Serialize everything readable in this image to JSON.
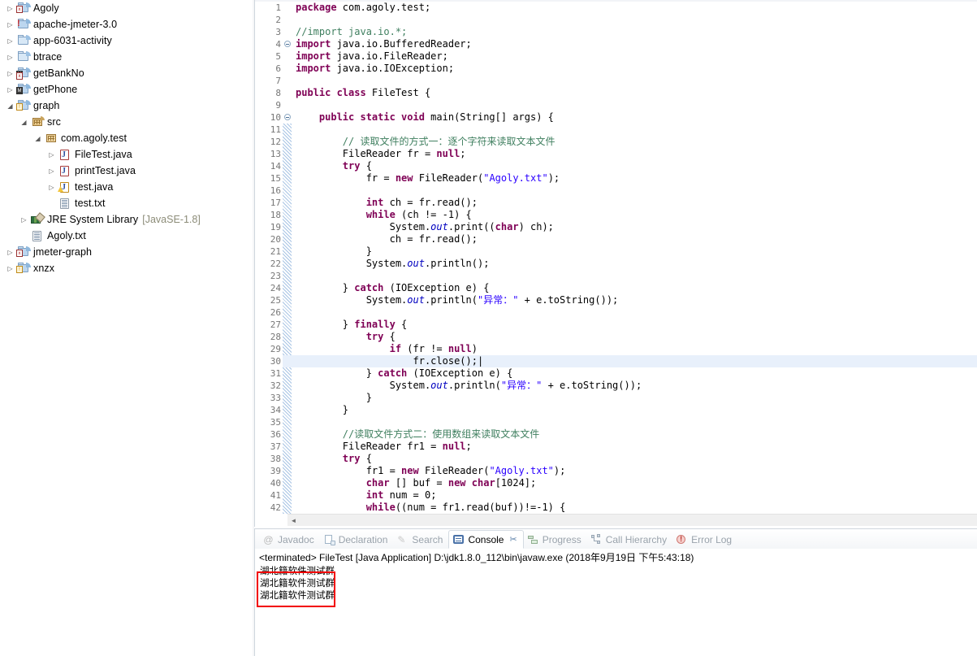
{
  "explorer": {
    "name": "package-explorer",
    "items": [
      {
        "label": "Agoly",
        "indent": 0,
        "twisty": "collapsed",
        "icon": "java-project-error-icon"
      },
      {
        "label": "apache-jmeter-3.0",
        "indent": 0,
        "twisty": "collapsed",
        "icon": "project-exclamation-icon"
      },
      {
        "label": "app-6031-activity",
        "indent": 0,
        "twisty": "collapsed",
        "icon": "folder-icon"
      },
      {
        "label": "btrace",
        "indent": 0,
        "twisty": "collapsed",
        "icon": "folder-icon"
      },
      {
        "label": "getBankNo",
        "indent": 0,
        "twisty": "collapsed",
        "icon": "maven-project-error-icon"
      },
      {
        "label": "getPhone",
        "indent": 0,
        "twisty": "collapsed",
        "icon": "maven-project-icon"
      },
      {
        "label": "graph",
        "indent": 0,
        "twisty": "expanded",
        "icon": "java-project-warning-icon"
      },
      {
        "label": "src",
        "indent": 1,
        "twisty": "expanded",
        "icon": "source-folder-icon"
      },
      {
        "label": "com.agoly.test",
        "indent": 2,
        "twisty": "expanded",
        "icon": "package-icon"
      },
      {
        "label": "FileTest.java",
        "indent": 3,
        "twisty": "collapsed",
        "icon": "java-file-icon"
      },
      {
        "label": "printTest.java",
        "indent": 3,
        "twisty": "collapsed",
        "icon": "java-file-icon"
      },
      {
        "label": "test.java",
        "indent": 3,
        "twisty": "collapsed",
        "icon": "java-file-warning-icon"
      },
      {
        "label": "test.txt",
        "indent": 3,
        "twisty": "none",
        "icon": "text-file-icon"
      },
      {
        "label": "JRE System Library",
        "sub": "[JavaSE-1.8]",
        "indent": 1,
        "twisty": "collapsed",
        "icon": "jre-library-icon"
      },
      {
        "label": "Agoly.txt",
        "indent": 1,
        "twisty": "none",
        "icon": "text-file-icon"
      },
      {
        "label": "jmeter-graph",
        "indent": 0,
        "twisty": "collapsed",
        "icon": "java-project-error-icon"
      },
      {
        "label": "xnzx",
        "indent": 0,
        "twisty": "collapsed",
        "icon": "java-project-warning-icon"
      }
    ]
  },
  "editor": {
    "name": "java-editor",
    "file": "FileTest.java",
    "highlighted_line": 30,
    "lines": [
      {
        "n": 1,
        "fold": "",
        "html": "<span class=\"kw\">package</span> com.agoly.test;"
      },
      {
        "n": 2,
        "fold": "",
        "html": ""
      },
      {
        "n": 3,
        "fold": "",
        "html": "<span class=\"cmt\">//import java.io.*;</span>"
      },
      {
        "n": 4,
        "fold": "minus",
        "html": "<span class=\"kw\">import</span> java.io.BufferedReader;"
      },
      {
        "n": 5,
        "fold": "",
        "html": "<span class=\"kw\">import</span> java.io.FileReader;"
      },
      {
        "n": 6,
        "fold": "",
        "html": "<span class=\"kw\">import</span> java.io.IOException;"
      },
      {
        "n": 7,
        "fold": "",
        "html": ""
      },
      {
        "n": 8,
        "fold": "",
        "html": "<span class=\"kw\">public class</span> FileTest {"
      },
      {
        "n": 9,
        "fold": "",
        "html": ""
      },
      {
        "n": 10,
        "fold": "minus",
        "html": "    <span class=\"kw\">public static void</span> main(String[] args) {"
      },
      {
        "n": 11,
        "fold": "",
        "html": ""
      },
      {
        "n": 12,
        "fold": "",
        "html": "        <span class=\"cmt\">// 读取文件的方式一：逐个字符来读取文本文件</span>"
      },
      {
        "n": 13,
        "fold": "",
        "html": "        FileReader fr = <span class=\"kw\">null</span>;"
      },
      {
        "n": 14,
        "fold": "",
        "html": "        <span class=\"kw\">try</span> {"
      },
      {
        "n": 15,
        "fold": "",
        "html": "            fr = <span class=\"kw\">new</span> FileReader(<span class=\"str\">\"Agoly.txt\"</span>);"
      },
      {
        "n": 16,
        "fold": "",
        "html": ""
      },
      {
        "n": 17,
        "fold": "",
        "html": "            <span class=\"kw\">int</span> ch = fr.read();"
      },
      {
        "n": 18,
        "fold": "",
        "html": "            <span class=\"kw\">while</span> (ch != -1) {"
      },
      {
        "n": 19,
        "fold": "",
        "html": "                System.<span class=\"fld\">out</span>.print((<span class=\"kw\">char</span>) ch);"
      },
      {
        "n": 20,
        "fold": "",
        "html": "                ch = fr.read();"
      },
      {
        "n": 21,
        "fold": "",
        "html": "            }"
      },
      {
        "n": 22,
        "fold": "",
        "html": "            System.<span class=\"fld\">out</span>.println();"
      },
      {
        "n": 23,
        "fold": "",
        "html": ""
      },
      {
        "n": 24,
        "fold": "",
        "html": "        } <span class=\"kw\">catch</span> (IOException e) {"
      },
      {
        "n": 25,
        "fold": "",
        "html": "            System.<span class=\"fld\">out</span>.println(<span class=\"str\">\"异常：\"</span> + e.toString());"
      },
      {
        "n": 26,
        "fold": "",
        "html": ""
      },
      {
        "n": 27,
        "fold": "",
        "html": "        } <span class=\"kw\">finally</span> {"
      },
      {
        "n": 28,
        "fold": "",
        "html": "            <span class=\"kw\">try</span> {"
      },
      {
        "n": 29,
        "fold": "",
        "html": "                <span class=\"kw\">if</span> (fr != <span class=\"kw\">null</span>)"
      },
      {
        "n": 30,
        "fold": "",
        "html": "                    fr.close();<span class=\"caret\">|</span>"
      },
      {
        "n": 31,
        "fold": "",
        "html": "            } <span class=\"kw\">catch</span> (IOException e) {"
      },
      {
        "n": 32,
        "fold": "",
        "html": "                System.<span class=\"fld\">out</span>.println(<span class=\"str\">\"异常：\"</span> + e.toString());"
      },
      {
        "n": 33,
        "fold": "",
        "html": "            }"
      },
      {
        "n": 34,
        "fold": "",
        "html": "        }"
      },
      {
        "n": 35,
        "fold": "",
        "html": ""
      },
      {
        "n": 36,
        "fold": "",
        "html": "        <span class=\"cmt\">//读取文件方式二：使用数组来读取文本文件</span>"
      },
      {
        "n": 37,
        "fold": "",
        "html": "        FileReader fr1 = <span class=\"kw\">null</span>;"
      },
      {
        "n": 38,
        "fold": "",
        "html": "        <span class=\"kw\">try</span> {"
      },
      {
        "n": 39,
        "fold": "",
        "html": "            fr1 = <span class=\"kw\">new</span> FileReader(<span class=\"str\">\"Agoly.txt\"</span>);"
      },
      {
        "n": 40,
        "fold": "",
        "html": "            <span class=\"kw\">char</span> [] buf = <span class=\"kw\">new</span> <span class=\"kw\">char</span>[1024];"
      },
      {
        "n": 41,
        "fold": "",
        "html": "            <span class=\"kw\">int</span> num = 0;"
      },
      {
        "n": 42,
        "fold": "",
        "html": "            <span class=\"kw\">while</span>((num = fr1.read(buf))!=-1) {"
      }
    ],
    "hscroll_left_arrow": "◄"
  },
  "bottom_panel": {
    "name": "console-view",
    "tabs": [
      {
        "label": "Javadoc",
        "icon": "at-icon",
        "active": false,
        "closable": false
      },
      {
        "label": "Declaration",
        "icon": "declaration-icon",
        "active": false,
        "closable": false
      },
      {
        "label": "Search",
        "icon": "search-icon",
        "active": false,
        "closable": false
      },
      {
        "label": "Console",
        "icon": "console-icon",
        "active": true,
        "closable": true
      },
      {
        "label": "Progress",
        "icon": "progress-icon",
        "active": false,
        "closable": false
      },
      {
        "label": "Call Hierarchy",
        "icon": "call-hierarchy-icon",
        "active": false,
        "closable": false
      },
      {
        "label": "Error Log",
        "icon": "error-log-icon",
        "active": false,
        "closable": false
      }
    ],
    "close_glyph": "✂",
    "status_line": "<terminated> FileTest [Java Application] D:\\jdk1.8.0_112\\bin\\javaw.exe (2018年9月19日 下午5:43:18)",
    "output_lines": [
      "湖北籍软件测试群",
      "湖北籍软件测试群",
      "湖北籍软件测试群"
    ],
    "annotation": {
      "name": "red-highlight-box",
      "color": "#f20000"
    }
  },
  "colors": {
    "keyword": "#7f0055",
    "string": "#2a00ff",
    "comment": "#3f7f5f",
    "field": "#0000c0",
    "highlight_line": "#e8f0fb",
    "accent_red": "#f20000"
  }
}
